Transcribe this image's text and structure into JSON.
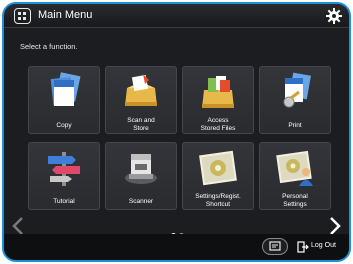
{
  "header": {
    "title": "Main Menu",
    "home_icon": "home-icon",
    "settings_icon": "gear-icon"
  },
  "instruction": "Select a function.",
  "tiles": [
    {
      "label": "Copy",
      "icon": "copy-icon"
    },
    {
      "label": "Scan and\nStore",
      "icon": "scan-store-icon"
    },
    {
      "label": "Access\nStored Files",
      "icon": "access-files-icon"
    },
    {
      "label": "Print",
      "icon": "print-icon"
    },
    {
      "label": "Tutorial",
      "icon": "tutorial-signpost-icon"
    },
    {
      "label": "Scanner",
      "icon": "scanner-icon"
    },
    {
      "label": "Settings/Regist.\nShortcut",
      "icon": "settings-shortcut-icon"
    },
    {
      "label": "Personal\nSettings",
      "icon": "personal-settings-icon"
    }
  ],
  "pagination": {
    "current": 1,
    "total": 2
  },
  "footer": {
    "logout_label": "Log Out"
  },
  "colors": {
    "frame": "#1f8fd8",
    "background": "#1c1d21",
    "tile": "#2f3034"
  }
}
